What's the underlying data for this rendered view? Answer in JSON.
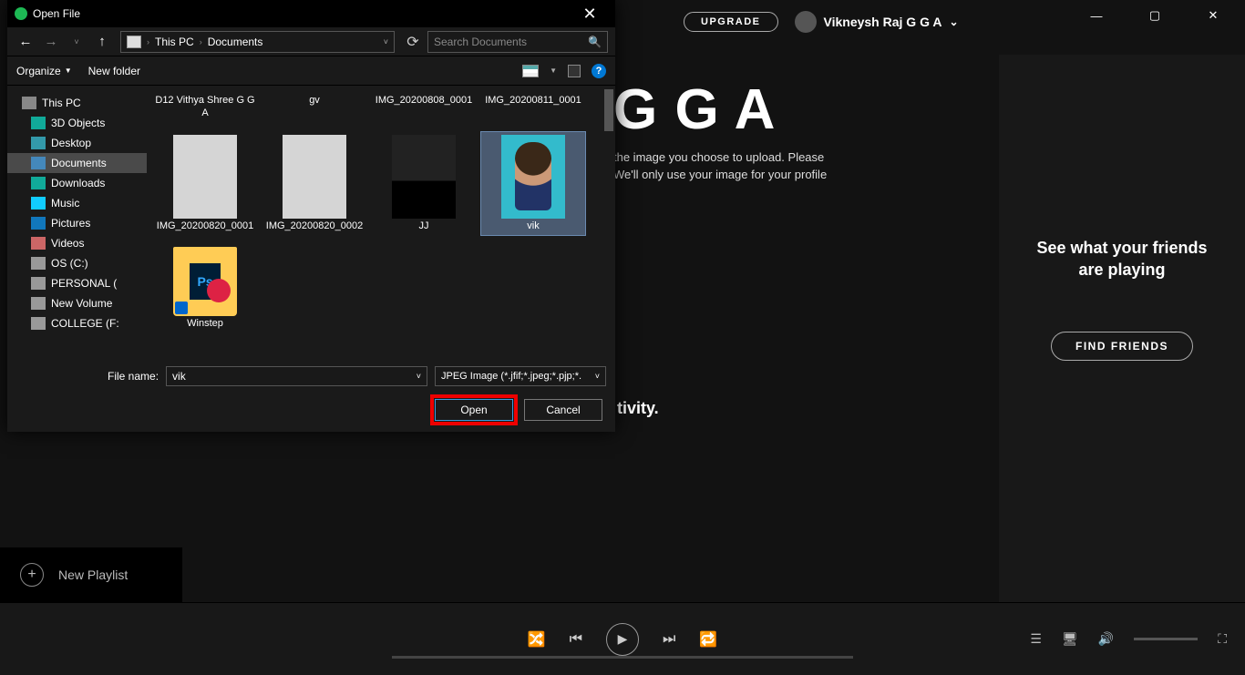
{
  "spotify": {
    "upgrade": "UPGRADE",
    "username": "Vikneysh Raj G G A",
    "profile_title": "G G A",
    "help_line1": "the image you choose to upload. Please",
    "help_line2": "We'll only use your image for your profile",
    "activity_tail": "tivity.",
    "friends_title": "See what your friends are playing",
    "find_friends": "FIND FRIENDS",
    "new_playlist": "New Playlist"
  },
  "dialog": {
    "title": "Open File",
    "organize": "Organize",
    "new_folder": "New folder",
    "path": {
      "root": "This PC",
      "folder": "Documents"
    },
    "search_placeholder": "Search Documents",
    "tree": [
      {
        "label": "This PC",
        "icon": "ico-pc",
        "root": true,
        "sel": false
      },
      {
        "label": "3D Objects",
        "icon": "ico-3d",
        "root": false,
        "sel": false
      },
      {
        "label": "Desktop",
        "icon": "ico-dt",
        "root": false,
        "sel": false
      },
      {
        "label": "Documents",
        "icon": "ico-doc",
        "root": false,
        "sel": true
      },
      {
        "label": "Downloads",
        "icon": "ico-dl",
        "root": false,
        "sel": false
      },
      {
        "label": "Music",
        "icon": "ico-mus",
        "root": false,
        "sel": false
      },
      {
        "label": "Pictures",
        "icon": "ico-pic",
        "root": false,
        "sel": false
      },
      {
        "label": "Videos",
        "icon": "ico-vid",
        "root": false,
        "sel": false
      },
      {
        "label": "OS (C:)",
        "icon": "ico-drv",
        "root": false,
        "sel": false
      },
      {
        "label": "PERSONAL (",
        "icon": "ico-drv",
        "root": false,
        "sel": false
      },
      {
        "label": "New Volume",
        "icon": "ico-drv",
        "root": false,
        "sel": false
      },
      {
        "label": "COLLEGE (F:",
        "icon": "ico-drv",
        "root": false,
        "sel": false
      }
    ],
    "files_row1": [
      {
        "name": "D12 Vithya Shree G G A"
      },
      {
        "name": "gv"
      },
      {
        "name": "IMG_20200808_0001"
      },
      {
        "name": "IMG_20200811_0001"
      }
    ],
    "files_row2": [
      {
        "name": "IMG_20200820_0001",
        "thumb": "page"
      },
      {
        "name": "IMG_20200820_0002",
        "thumb": "page"
      },
      {
        "name": "JJ",
        "thumb": "dark"
      },
      {
        "name": "vik",
        "thumb": "vik",
        "sel": true
      }
    ],
    "files_row3": [
      {
        "name": "Winstep",
        "thumb": "folder"
      }
    ],
    "filename_label": "File name:",
    "filename_value": "vik",
    "filter": "JPEG Image (*.jfif;*.jpeg;*.pjp;*.",
    "open": "Open",
    "cancel": "Cancel"
  }
}
